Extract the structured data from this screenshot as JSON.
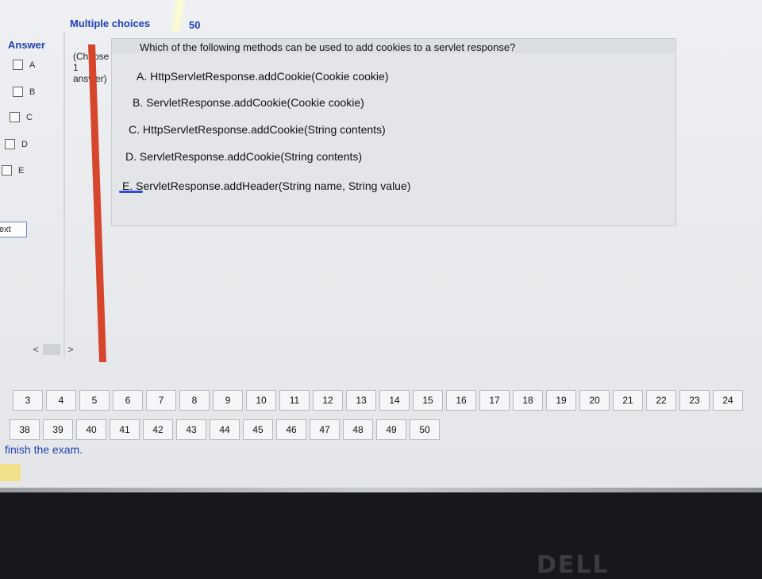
{
  "header": {
    "title": "Multiple choices",
    "count": "50"
  },
  "answer_panel": {
    "label": "Answer",
    "hint_lines": [
      "(Choose",
      "1",
      "answer)"
    ],
    "options": [
      "A",
      "B",
      "C",
      "D",
      "E"
    ],
    "next_label": "ext"
  },
  "scroll": {
    "prev": "<",
    "next": ">"
  },
  "question": {
    "text": "Which of the following methods can be used to add cookies to a servlet response?",
    "choices": [
      "A. HttpServletResponse.addCookie(Cookie cookie)",
      "B. ServletResponse.addCookie(Cookie cookie)",
      "C. HttpServletResponse.addCookie(String contents)",
      "D. ServletResponse.addCookie(String contents)",
      "E. ServletResponse.addHeader(String name, String value)"
    ]
  },
  "pager_row1": [
    "3",
    "4",
    "5",
    "6",
    "7",
    "8",
    "9",
    "10",
    "11",
    "12",
    "13",
    "14",
    "15",
    "16",
    "17",
    "18",
    "19",
    "20",
    "21",
    "22",
    "23",
    "24"
  ],
  "pager_row2": [
    "38",
    "39",
    "40",
    "41",
    "42",
    "43",
    "44",
    "45",
    "46",
    "47",
    "48",
    "49",
    "50"
  ],
  "footer": {
    "finish_text": "finish the exam."
  },
  "logo_text": "DELL"
}
